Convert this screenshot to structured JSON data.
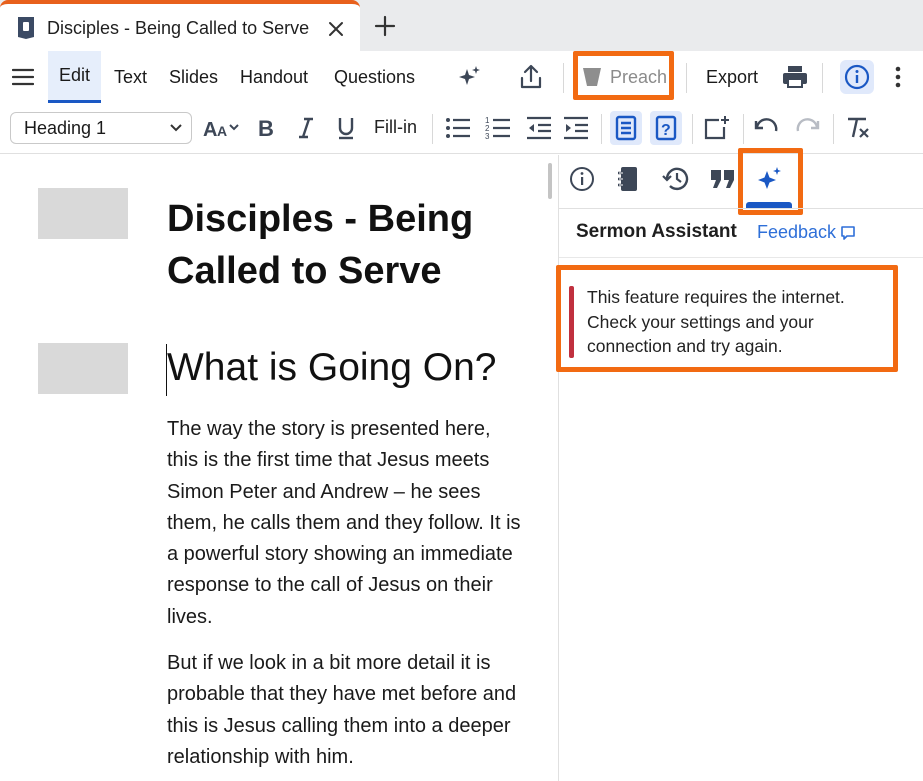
{
  "tab": {
    "title": "Disciples - Being Called to Serve",
    "icon": "document-icon",
    "close_icon": "close-icon",
    "new_tab_icon": "plus-icon"
  },
  "toolbar": {
    "menu_icon": "hamburger-icon",
    "edit": "Edit",
    "text": "Text",
    "slides": "Slides",
    "handout": "Handout",
    "questions": "Questions",
    "sparkle_icon": "sparkle-icon",
    "share_icon": "share-icon",
    "preach": "Preach",
    "export": "Export",
    "print_icon": "print-icon",
    "info_icon": "info-icon",
    "more_icon": "more-vertical-icon"
  },
  "format": {
    "style_value": "Heading 1",
    "fill_in": "Fill-in"
  },
  "document": {
    "title": "Disciples - Being Called to Serve",
    "heading": "What is Going On?",
    "paragraph1": "The way the story is presented here, this is the first time that Jesus meets Simon Peter and Andrew – he sees them, he calls them and they follow. It is a powerful story showing an immediate response to the call of Jesus on their lives.",
    "paragraph2": "But if we look in a bit more detail it is probable that they have met before and this is Jesus calling them into a deeper relationship with him."
  },
  "panel": {
    "title": "Sermon Assistant",
    "feedback": "Feedback",
    "message": "This feature requires the internet. Check your settings and your connection and try again."
  },
  "colors": {
    "accent": "#1a58c4",
    "highlight_orange": "#f26a12",
    "error_bar": "#c0303e"
  }
}
